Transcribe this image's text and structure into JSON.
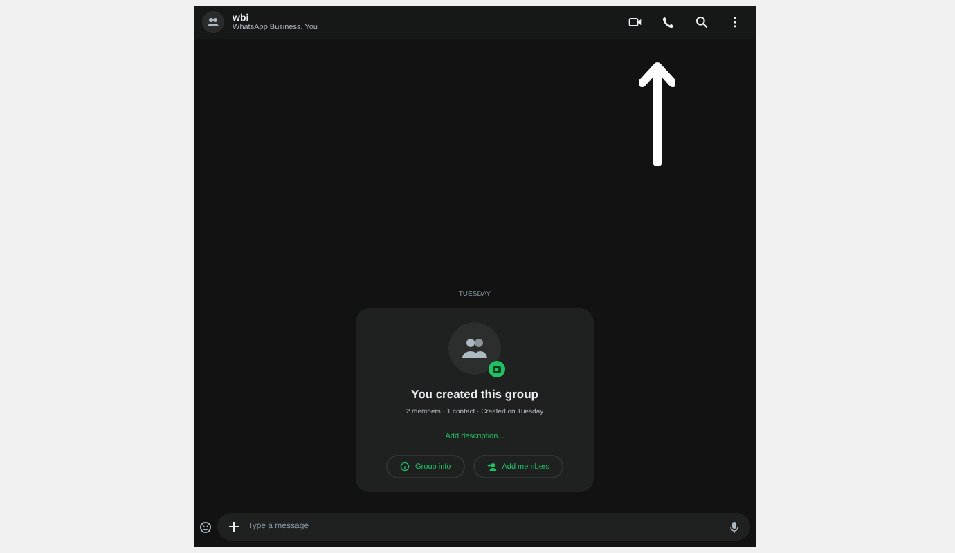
{
  "header": {
    "title": "wbi",
    "subtitle": "WhatsApp Business, You"
  },
  "date_chip": "TUESDAY",
  "group_card": {
    "title": "You created this group",
    "meta": "2 members · 1 contact · Created on Tuesday",
    "link": "Add description...",
    "buttons": [
      {
        "kind": "info",
        "label": "Group info"
      },
      {
        "kind": "add",
        "label": "Add members"
      }
    ]
  },
  "composer": {
    "placeholder": "Type a message"
  }
}
